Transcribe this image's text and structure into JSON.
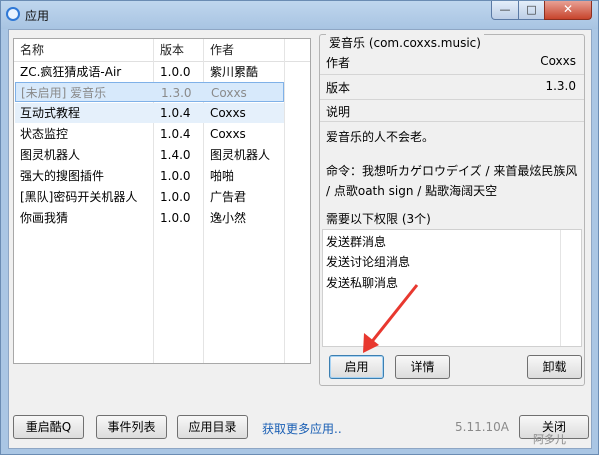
{
  "window": {
    "title": "应用",
    "close_glyph": "✕",
    "minimize_glyph": "—",
    "maximize_glyph": "□"
  },
  "list": {
    "columns": [
      "名称",
      "版本",
      "作者"
    ],
    "rows": [
      {
        "name": "ZC.疯狂猜成语-Air",
        "version": "1.0.0",
        "author": "紫川累酷",
        "state": "normal"
      },
      {
        "name": "[未启用] 爱音乐",
        "version": "1.3.0",
        "author": "Coxxs",
        "state": "disabled-selected"
      },
      {
        "name": "互动式教程",
        "version": "1.0.4",
        "author": "Coxxs",
        "state": "highlight"
      },
      {
        "name": "状态监控",
        "version": "1.0.4",
        "author": "Coxxs",
        "state": "normal"
      },
      {
        "name": "图灵机器人",
        "version": "1.4.0",
        "author": "图灵机器人",
        "state": "normal"
      },
      {
        "name": "强大的搜图插件",
        "version": "1.0.0",
        "author": "啪啪",
        "state": "normal"
      },
      {
        "name": "[黑队]密码开关机器人",
        "version": "1.0.0",
        "author": "广告君",
        "state": "normal"
      },
      {
        "name": "你画我猜",
        "version": "1.0.0",
        "author": "逸小然",
        "state": "normal"
      }
    ]
  },
  "detail": {
    "group_title": "爱音乐 (com.coxxs.music)",
    "author_label": "作者",
    "author_value": "Coxxs",
    "version_label": "版本",
    "version_value": "1.3.0",
    "desc_label": "说明",
    "description": "爱音乐的人不会老。",
    "command": "命令：我想听カゲロウデイズ / 来首最炫民族风 / 点歌oath sign / 點歌海阔天空",
    "permissions_title": "需要以下权限 (3个)",
    "permissions": [
      "发送群消息",
      "发送讨论组消息",
      "发送私聊消息"
    ],
    "enable_button": "启用",
    "details_button": "详情",
    "uninstall_button": "卸载"
  },
  "footer": {
    "restart_button": "重启酷Q",
    "events_button": "事件列表",
    "appdir_button": "应用目录",
    "more_link": "获取更多应用..",
    "version_text": "5.11.10A",
    "close_button": "关闭"
  },
  "watermark": "阿多儿",
  "colors": {
    "accent": "#3c7fb1",
    "selected_row": "#d7e9fb",
    "link": "#1a5fb4",
    "arrow": "#e8382f"
  }
}
